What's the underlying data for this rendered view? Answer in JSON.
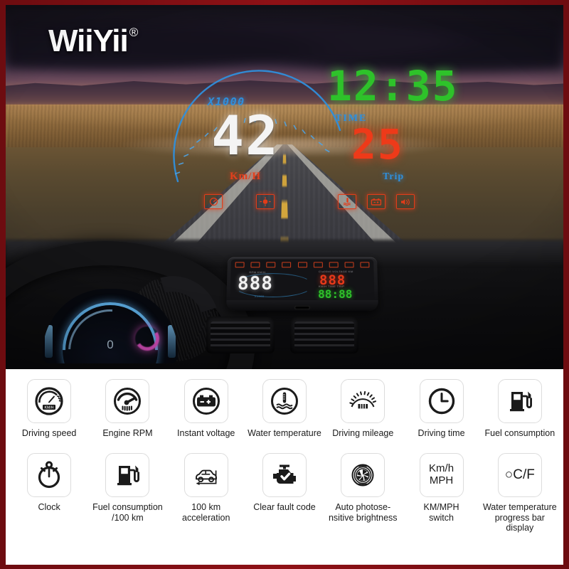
{
  "brand": {
    "logo_text": "WiiYii",
    "trademark": "®"
  },
  "hud": {
    "rpm_label": "X1000",
    "speed_value": "42",
    "speed_unit": "Km/H",
    "clock_value": "12:35",
    "clock_label": "TIME",
    "trip_value": "25",
    "trip_label": "Trip",
    "accent_red": "#e23c19",
    "accent_blue": "#2f8fdc",
    "accent_green": "#2ec22a",
    "warning_icons": [
      "speedometer-warning-icon",
      "brightness-warning-icon",
      "water-temperature-warning-icon",
      "battery-warning-icon",
      "speaker-warning-icon"
    ]
  },
  "device": {
    "white_display": "888",
    "red_display": "888",
    "green_display": "88:88",
    "indicator_count": 9,
    "tiny_labels": [
      "RPM",
      "KM/H",
      "C°",
      "VOLTAGE",
      "MPH",
      "KM",
      "TIME",
      "TRIP"
    ]
  },
  "features": {
    "row1": [
      {
        "label": "Driving speed",
        "icon": "speedometer-icon",
        "tile_text": ""
      },
      {
        "label": "Engine RPM",
        "icon": "tachometer-icon",
        "tile_text": ""
      },
      {
        "label": "Instant voltage",
        "icon": "battery-icon",
        "tile_text": ""
      },
      {
        "label": "Water temperature",
        "icon": "water-thermometer-icon",
        "tile_text": ""
      },
      {
        "label": "Driving mileage",
        "icon": "odometer-icon",
        "tile_text": ""
      },
      {
        "label": "Driving time",
        "icon": "clock-icon",
        "tile_text": ""
      },
      {
        "label": "Fuel consumption",
        "icon": "fuel-pump-icon",
        "tile_text": ""
      }
    ],
    "row2": [
      {
        "label": "Clock",
        "icon": "stopwatch-icon",
        "tile_text": ""
      },
      {
        "label": "Fuel consumption\n/100 km",
        "icon": "fuel-pump-icon",
        "tile_text": ""
      },
      {
        "label": "100 km\nacceleration",
        "icon": "car-acceleration-icon",
        "tile_text": ""
      },
      {
        "label": "Clear fault code",
        "icon": "engine-check-icon",
        "tile_text": ""
      },
      {
        "label": "Auto photose-\nnsitive brightness",
        "icon": "aperture-icon",
        "tile_text": ""
      },
      {
        "label": "KM/MPH\nswitch",
        "icon": "text-tile",
        "tile_text": "Km/h\nMPH"
      },
      {
        "label": "Water temperature\nprogress bar display",
        "icon": "text-tile",
        "tile_text": "○C/F"
      }
    ]
  },
  "speedometer_tile": {
    "unit_text": "KM/H"
  }
}
